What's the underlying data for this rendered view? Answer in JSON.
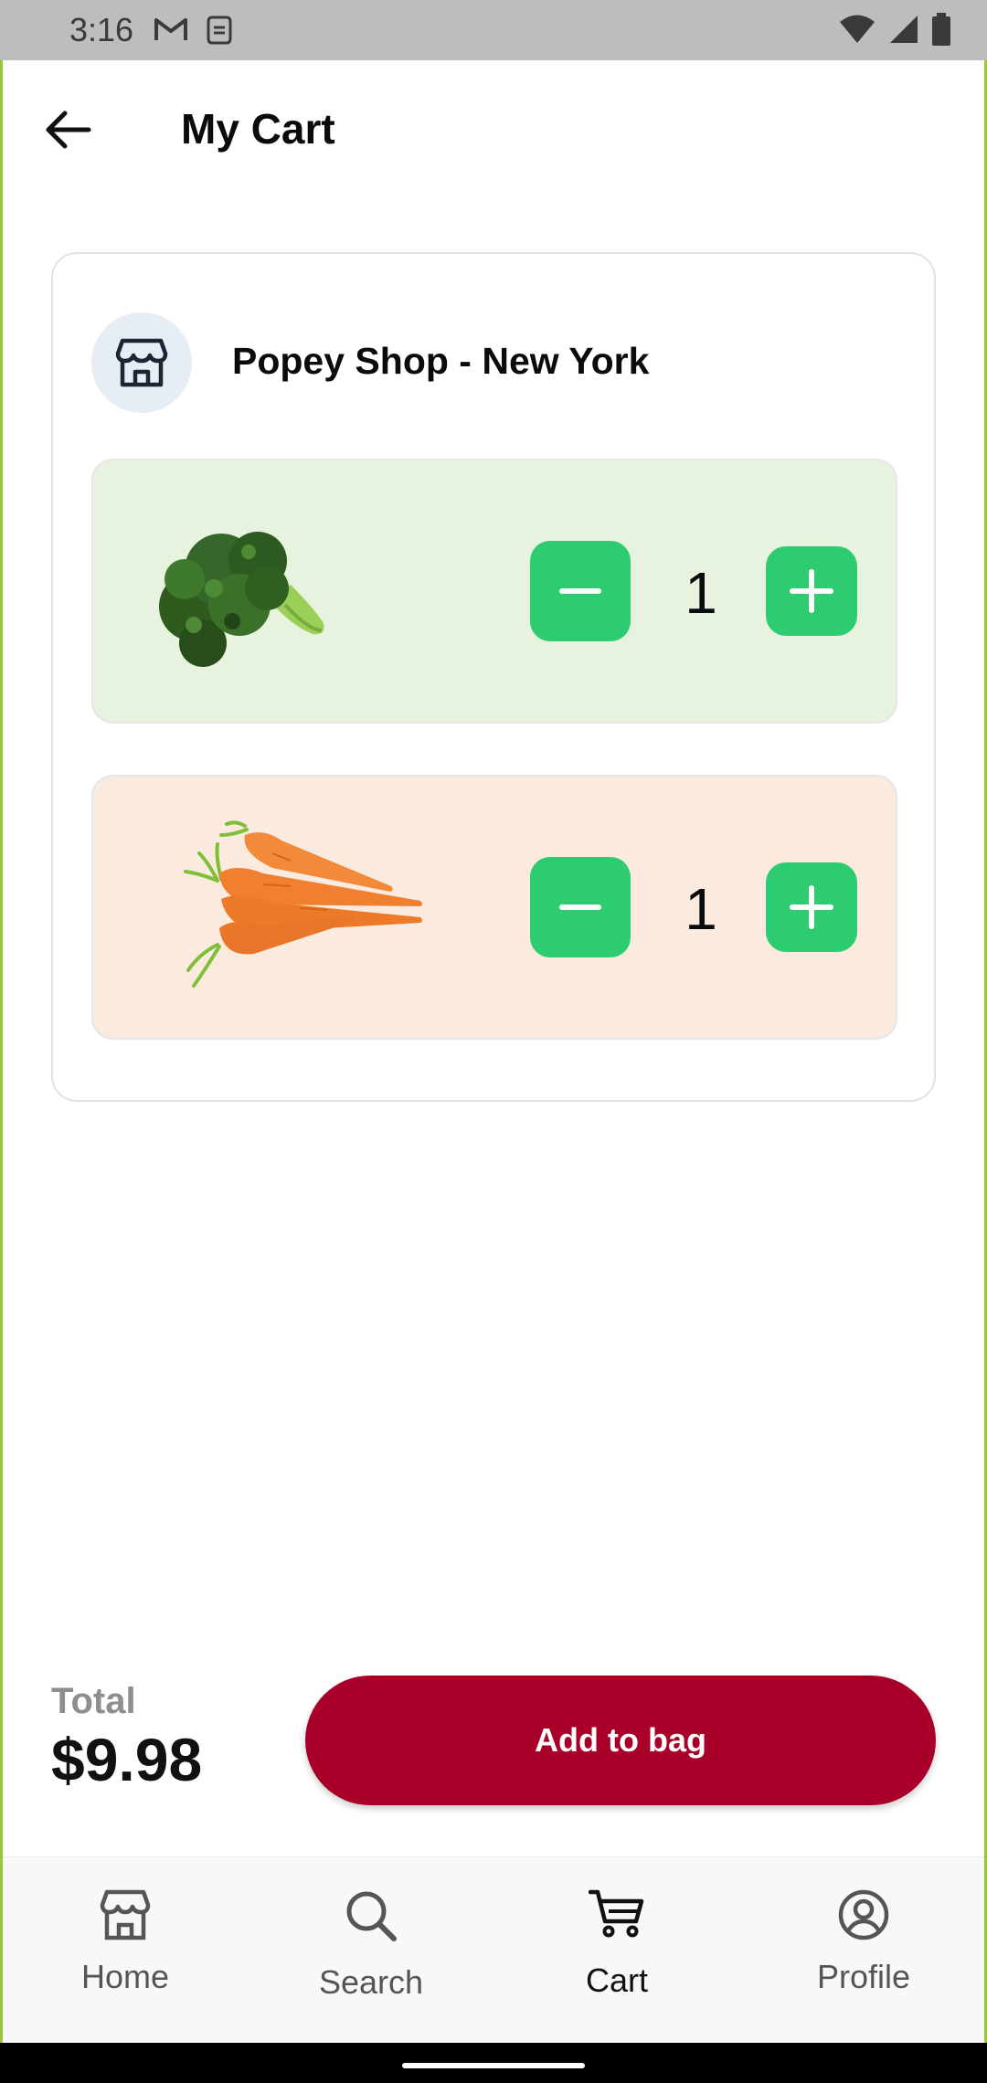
{
  "status_bar": {
    "time": "3:16",
    "icons": [
      "gmail-icon",
      "sim-icon",
      "wifi-icon",
      "signal-icon",
      "battery-icon"
    ]
  },
  "header": {
    "title": "My Cart",
    "back_icon": "arrow-left-icon"
  },
  "cart": {
    "shop_icon": "store-icon",
    "shop_name": "Popey Shop - New York",
    "items": [
      {
        "name": "broccoli",
        "quantity": "1",
        "background": "#e8f3df"
      },
      {
        "name": "carrots",
        "quantity": "1",
        "background": "#fbeade"
      }
    ]
  },
  "summary": {
    "total_label": "Total",
    "total_amount": "$9.98",
    "add_button_label": "Add to bag"
  },
  "bottom_nav": {
    "items": [
      {
        "label": "Home",
        "icon": "store-icon",
        "active": false
      },
      {
        "label": "Search",
        "icon": "search-icon",
        "active": false
      },
      {
        "label": "Cart",
        "icon": "cart-icon",
        "active": true
      },
      {
        "label": "Profile",
        "icon": "profile-icon",
        "active": false
      }
    ]
  },
  "colors": {
    "accent_green": "#2ecc71",
    "button_red": "#a80028",
    "status_bar": "#bdbdbd"
  }
}
